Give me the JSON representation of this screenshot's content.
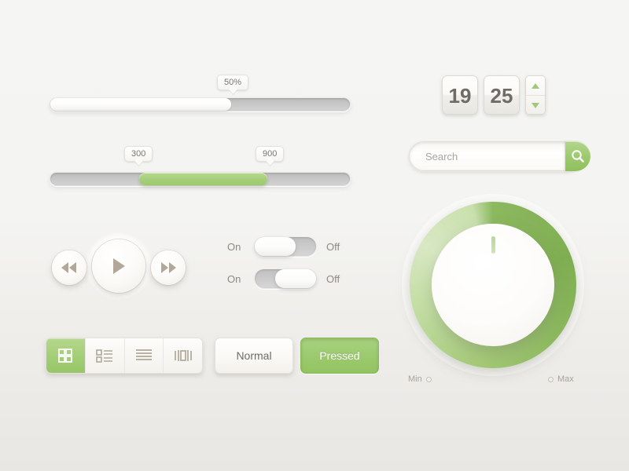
{
  "colors": {
    "accent_green": "#9cc96d",
    "accent_green_dark": "#7fae52",
    "accent_green_light": "#c2dda2",
    "track_gray": "#c9c9c9",
    "text_gray": "#6f6c66",
    "label_gray": "#8d8a83",
    "icon_taupe": "#b3a79a",
    "bg_top": "#f5f5f3",
    "bg_bottom": "#e9e7e4"
  },
  "sliders": {
    "progress": {
      "name": "progress-slider",
      "tooltip": "50%",
      "value": 50,
      "min": 0,
      "max": 100,
      "fill_style": "white"
    },
    "range": {
      "name": "range-slider",
      "tooltip_low": "300",
      "tooltip_high": "900",
      "value_low": 300,
      "value_high": 900,
      "min": 0,
      "max": 1600,
      "fill_style": "green"
    }
  },
  "stepper": {
    "hours": "19",
    "minutes": "25",
    "increment_icon": "triangle-up-icon",
    "decrement_icon": "triangle-down-icon"
  },
  "search": {
    "placeholder": "Search",
    "value": "",
    "button_icon": "search-icon"
  },
  "transport": {
    "rewind_label": "◀◀",
    "play_label": "▶",
    "forward_label": "▶▶",
    "rewind_icon": "rewind-icon",
    "play_icon": "play-icon",
    "forward_icon": "fast-forward-icon"
  },
  "toggles": [
    {
      "on_label": "On",
      "off_label": "Off",
      "state": "on",
      "knob_position": "left"
    },
    {
      "on_label": "On",
      "off_label": "Off",
      "state": "off",
      "knob_position": "right"
    }
  ],
  "segmented": {
    "items": [
      {
        "icon": "grid-view-icon",
        "label": "Grid view",
        "active": true
      },
      {
        "icon": "list-view-icon",
        "label": "List view",
        "active": false
      },
      {
        "icon": "lines-view-icon",
        "label": "Lines view",
        "active": false
      },
      {
        "icon": "coverflow-view-icon",
        "label": "Cover flow",
        "active": false
      }
    ]
  },
  "buttons": {
    "normal_label": "Normal",
    "pressed_label": "Pressed"
  },
  "knob": {
    "min_label": "Min",
    "max_label": "Max",
    "value": 0,
    "indicator_position_deg": 0
  }
}
